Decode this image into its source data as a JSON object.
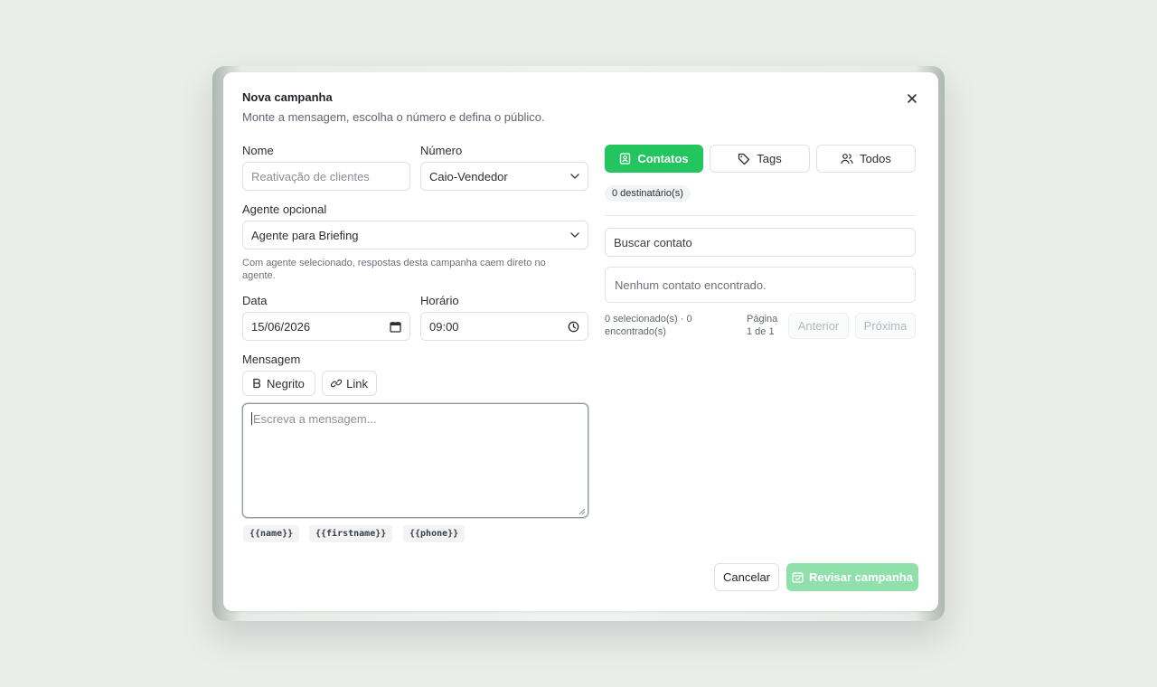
{
  "dialog": {
    "title": "Nova campanha",
    "subtitle": "Monte a mensagem, escolha o número e defina o público."
  },
  "form": {
    "name_label": "Nome",
    "name_placeholder": "Reativação de clientes",
    "number_label": "Número",
    "number_value": "Caio-Vendedor",
    "agent_label": "Agente opcional",
    "agent_value": "Agente para Briefing",
    "agent_hint": "Com agente selecionado, respostas desta campanha caem direto no agente.",
    "date_label": "Data",
    "date_value": "15/06/2026",
    "time_label": "Horário",
    "time_value": "09:00",
    "message_label": "Mensagem",
    "bold_label": "Negrito",
    "link_label": "Link",
    "message_placeholder": "Escreva a mensagem...",
    "variables": [
      "{{name}}",
      "{{firstname}}",
      "{{phone}}"
    ]
  },
  "audience": {
    "tabs": [
      {
        "label": "Contatos",
        "icon": "contact-book-icon",
        "active": true
      },
      {
        "label": "Tags",
        "icon": "tag-icon",
        "active": false
      },
      {
        "label": "Todos",
        "icon": "users-icon",
        "active": false
      }
    ],
    "recipients_badge": "0 destinatário(s)",
    "search_placeholder": "Buscar contato",
    "empty_text": "Nenhum contato encontrado.",
    "selection_summary": "0 selecionado(s) · 0 encontrado(s)",
    "page_info": "Página 1 de 1",
    "prev_label": "Anterior",
    "next_label": "Próxima"
  },
  "footer": {
    "cancel_label": "Cancelar",
    "review_label": "Revisar campanha"
  },
  "colors": {
    "accent": "#22c55e",
    "accent_disabled": "#8fe0ab"
  }
}
